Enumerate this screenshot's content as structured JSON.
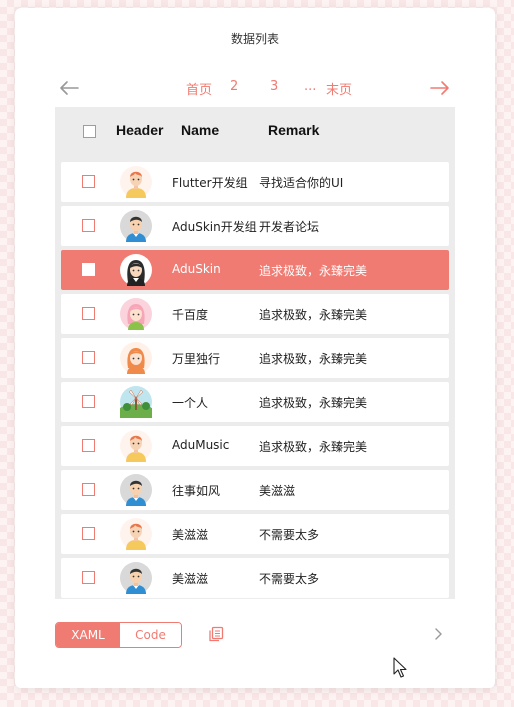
{
  "title": "数据列表",
  "pagination": {
    "first": "首页",
    "p2": "2",
    "p3": "3",
    "ellipsis": "...",
    "last": "末页"
  },
  "grid": {
    "columns": [
      "Header",
      "Name",
      "Remark"
    ],
    "rows": [
      {
        "name": "Flutter开发组",
        "remark": "寻找适合你的UI",
        "avatar": "boy-orange-hair-icon",
        "selected": false
      },
      {
        "name": "AduSkin开发组",
        "remark": "开发者论坛",
        "avatar": "man-avatar-icon",
        "selected": false
      },
      {
        "name": "AduSkin",
        "remark": "追求极致，永臻完美",
        "avatar": "girl-dark-hair-icon",
        "selected": true
      },
      {
        "name": "千百度",
        "remark": "追求极致，永臻完美",
        "avatar": "pink-hair-girl-icon",
        "selected": false
      },
      {
        "name": "万里独行",
        "remark": "追求极致，永臻完美",
        "avatar": "orange-hair-woman-icon",
        "selected": false
      },
      {
        "name": "一个人",
        "remark": "追求极致，永臻完美",
        "avatar": "windmill-landscape-icon",
        "selected": false
      },
      {
        "name": "AduMusic",
        "remark": "追求极致，永臻完美",
        "avatar": "boy-orange-hair-icon",
        "selected": false
      },
      {
        "name": "往事如风",
        "remark": "美滋滋",
        "avatar": "man-avatar-icon",
        "selected": false
      },
      {
        "name": "美滋滋",
        "remark": "不需要太多",
        "avatar": "boy-orange-hair-icon",
        "selected": false
      },
      {
        "name": "美滋滋",
        "remark": "不需要太多",
        "avatar": "man-avatar-icon",
        "selected": false
      }
    ]
  },
  "footer": {
    "xaml": "XAML",
    "code": "Code"
  },
  "colors": {
    "accent": "#f07b72",
    "grid_bg": "#ececec"
  }
}
